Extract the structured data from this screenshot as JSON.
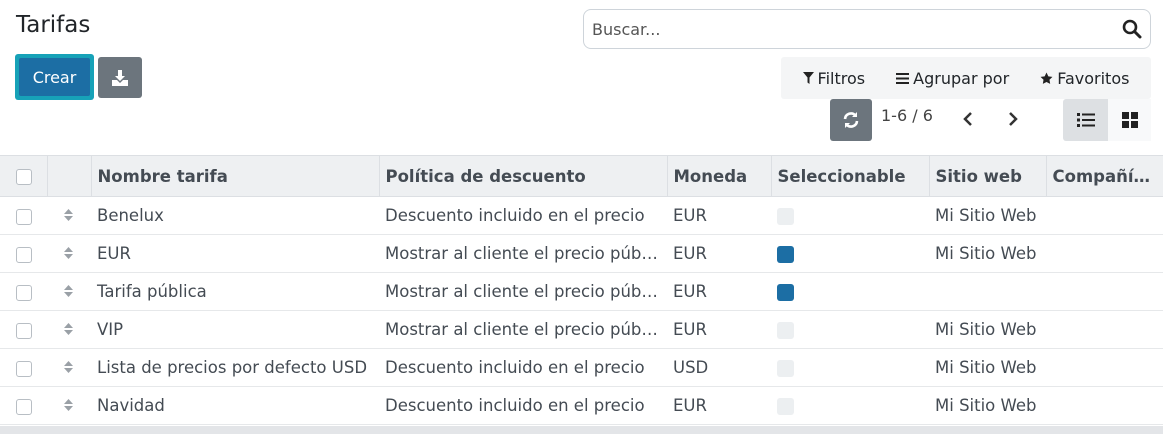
{
  "page": {
    "title": "Tarifas"
  },
  "search": {
    "placeholder": "Buscar..."
  },
  "actions": {
    "create_label": "Crear"
  },
  "filters": {
    "filtros": "Filtros",
    "agrupar": "Agrupar por",
    "favoritos": "Favoritos"
  },
  "pager": {
    "text": "1-6 / 6"
  },
  "table": {
    "columns": [
      "Nombre tarifa",
      "Política de descuento",
      "Moneda",
      "Seleccionable",
      "Sitio web",
      "Compañía..."
    ],
    "rows": [
      {
        "name": "Benelux",
        "policy": "Descuento incluido en el precio",
        "currency": "EUR",
        "selectable": false,
        "website": "Mi Sitio Web",
        "company": ""
      },
      {
        "name": "EUR",
        "policy": "Mostrar al cliente el precio público",
        "currency": "EUR",
        "selectable": true,
        "website": "Mi Sitio Web",
        "company": ""
      },
      {
        "name": "Tarifa pública",
        "policy": "Mostrar al cliente el precio público",
        "currency": "EUR",
        "selectable": true,
        "website": "",
        "company": ""
      },
      {
        "name": "VIP",
        "policy": "Mostrar al cliente el precio público",
        "currency": "EUR",
        "selectable": false,
        "website": "Mi Sitio Web",
        "company": ""
      },
      {
        "name": "Lista de precios por defecto USD",
        "policy": "Descuento incluido en el precio",
        "currency": "USD",
        "selectable": false,
        "website": "Mi Sitio Web",
        "company": ""
      },
      {
        "name": "Navidad",
        "policy": "Descuento incluido en el precio",
        "currency": "EUR",
        "selectable": false,
        "website": "Mi Sitio Web",
        "company": ""
      }
    ]
  },
  "colors": {
    "primary": "#1c6ea4",
    "focus_ring": "#17a2b8",
    "secondary": "#6c757d"
  }
}
